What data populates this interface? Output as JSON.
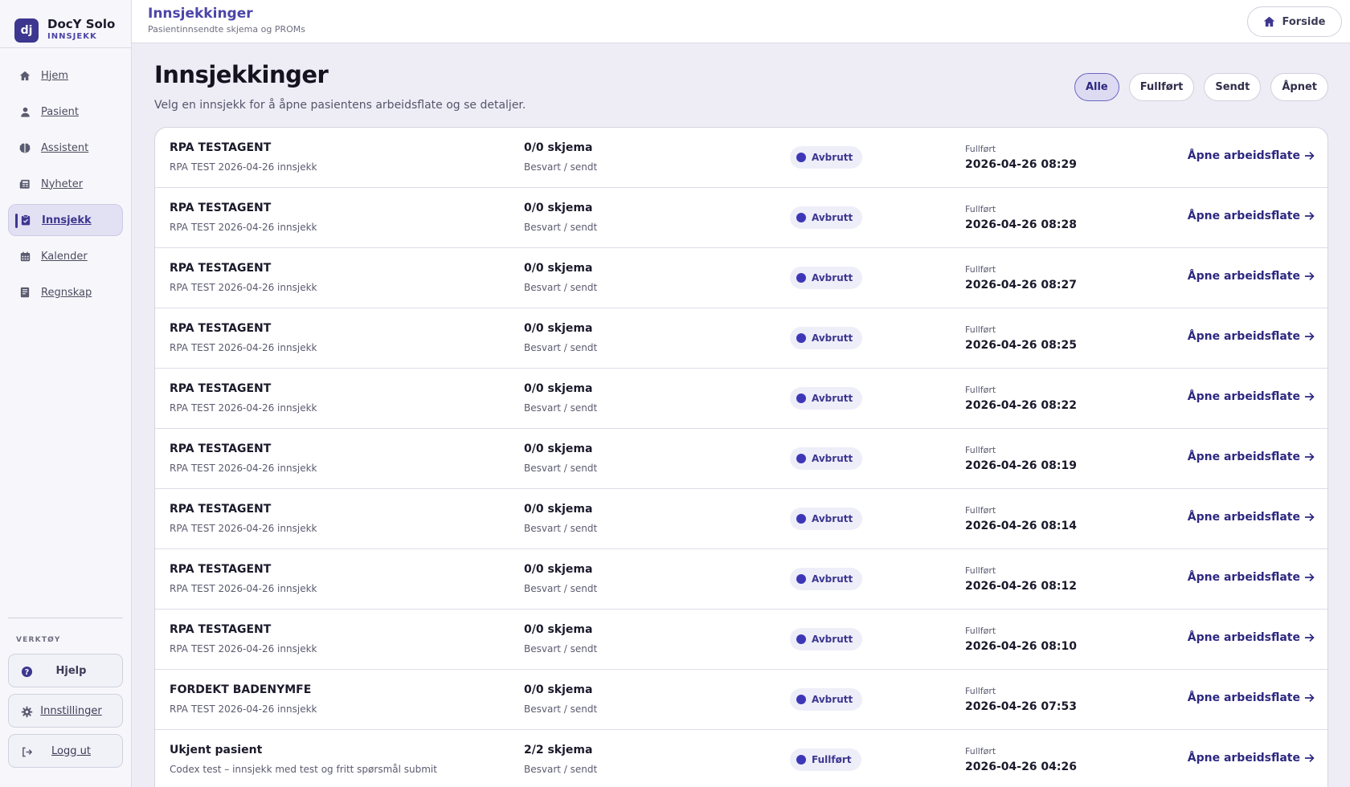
{
  "brand": {
    "logo": "dj",
    "name": "DocY Solo",
    "sub": "INNSJEKK"
  },
  "nav": [
    {
      "label": "Hjem",
      "icon": "home-icon",
      "active": false
    },
    {
      "label": "Pasient",
      "icon": "user-icon",
      "active": false
    },
    {
      "label": "Assistent",
      "icon": "brain-icon",
      "active": false
    },
    {
      "label": "Nyheter",
      "icon": "newspaper-icon",
      "active": false
    },
    {
      "label": "Innsjekk",
      "icon": "clipboard-icon",
      "active": true
    },
    {
      "label": "Kalender",
      "icon": "calendar-icon",
      "active": false
    },
    {
      "label": "Regnskap",
      "icon": "receipt-icon",
      "active": false
    }
  ],
  "tools": {
    "title": "VERKTØY",
    "help": "Hjelp",
    "settings": "Innstillinger",
    "logout": "Logg ut"
  },
  "header": {
    "title": "Innsjekkinger",
    "subtitle": "Pasientinnsendte skjema og PROMs",
    "home_button": "Forside"
  },
  "main": {
    "title": "Innsjekkinger",
    "description": "Velg en innsjekk for å åpne pasientens arbeidsflate og se detaljer.",
    "filters": [
      {
        "label": "Alle",
        "active": true
      },
      {
        "label": "Fullført",
        "active": false
      },
      {
        "label": "Sendt",
        "active": false
      },
      {
        "label": "Åpnet",
        "active": false
      }
    ]
  },
  "rows": [
    {
      "patient": "RPA TESTAGENT",
      "desc": "RPA TEST 2026-04-26 innsjekk",
      "count": "0/0 skjema",
      "count_sub": "Besvart / sendt",
      "status": "Avbrutt",
      "date_label": "Fullført",
      "date": "2026-04-26 08:29",
      "link": "Åpne arbeidsflate"
    },
    {
      "patient": "RPA TESTAGENT",
      "desc": "RPA TEST 2026-04-26 innsjekk",
      "count": "0/0 skjema",
      "count_sub": "Besvart / sendt",
      "status": "Avbrutt",
      "date_label": "Fullført",
      "date": "2026-04-26 08:28",
      "link": "Åpne arbeidsflate"
    },
    {
      "patient": "RPA TESTAGENT",
      "desc": "RPA TEST 2026-04-26 innsjekk",
      "count": "0/0 skjema",
      "count_sub": "Besvart / sendt",
      "status": "Avbrutt",
      "date_label": "Fullført",
      "date": "2026-04-26 08:27",
      "link": "Åpne arbeidsflate"
    },
    {
      "patient": "RPA TESTAGENT",
      "desc": "RPA TEST 2026-04-26 innsjekk",
      "count": "0/0 skjema",
      "count_sub": "Besvart / sendt",
      "status": "Avbrutt",
      "date_label": "Fullført",
      "date": "2026-04-26 08:25",
      "link": "Åpne arbeidsflate"
    },
    {
      "patient": "RPA TESTAGENT",
      "desc": "RPA TEST 2026-04-26 innsjekk",
      "count": "0/0 skjema",
      "count_sub": "Besvart / sendt",
      "status": "Avbrutt",
      "date_label": "Fullført",
      "date": "2026-04-26 08:22",
      "link": "Åpne arbeidsflate"
    },
    {
      "patient": "RPA TESTAGENT",
      "desc": "RPA TEST 2026-04-26 innsjekk",
      "count": "0/0 skjema",
      "count_sub": "Besvart / sendt",
      "status": "Avbrutt",
      "date_label": "Fullført",
      "date": "2026-04-26 08:19",
      "link": "Åpne arbeidsflate"
    },
    {
      "patient": "RPA TESTAGENT",
      "desc": "RPA TEST 2026-04-26 innsjekk",
      "count": "0/0 skjema",
      "count_sub": "Besvart / sendt",
      "status": "Avbrutt",
      "date_label": "Fullført",
      "date": "2026-04-26 08:14",
      "link": "Åpne arbeidsflate"
    },
    {
      "patient": "RPA TESTAGENT",
      "desc": "RPA TEST 2026-04-26 innsjekk",
      "count": "0/0 skjema",
      "count_sub": "Besvart / sendt",
      "status": "Avbrutt",
      "date_label": "Fullført",
      "date": "2026-04-26 08:12",
      "link": "Åpne arbeidsflate"
    },
    {
      "patient": "RPA TESTAGENT",
      "desc": "RPA TEST 2026-04-26 innsjekk",
      "count": "0/0 skjema",
      "count_sub": "Besvart / sendt",
      "status": "Avbrutt",
      "date_label": "Fullført",
      "date": "2026-04-26 08:10",
      "link": "Åpne arbeidsflate"
    },
    {
      "patient": "FORDEKT BADENYMFE",
      "desc": "RPA TEST 2026-04-26 innsjekk",
      "count": "0/0 skjema",
      "count_sub": "Besvart / sendt",
      "status": "Avbrutt",
      "date_label": "Fullført",
      "date": "2026-04-26 07:53",
      "link": "Åpne arbeidsflate"
    },
    {
      "patient": "Ukjent pasient",
      "desc": "Codex test – innsjekk med test og fritt spørsmål submit",
      "count": "2/2 skjema",
      "count_sub": "Besvart / sendt",
      "status": "Fullført",
      "date_label": "Fullført",
      "date": "2026-04-26 04:26",
      "link": "Åpne arbeidsflate"
    }
  ]
}
